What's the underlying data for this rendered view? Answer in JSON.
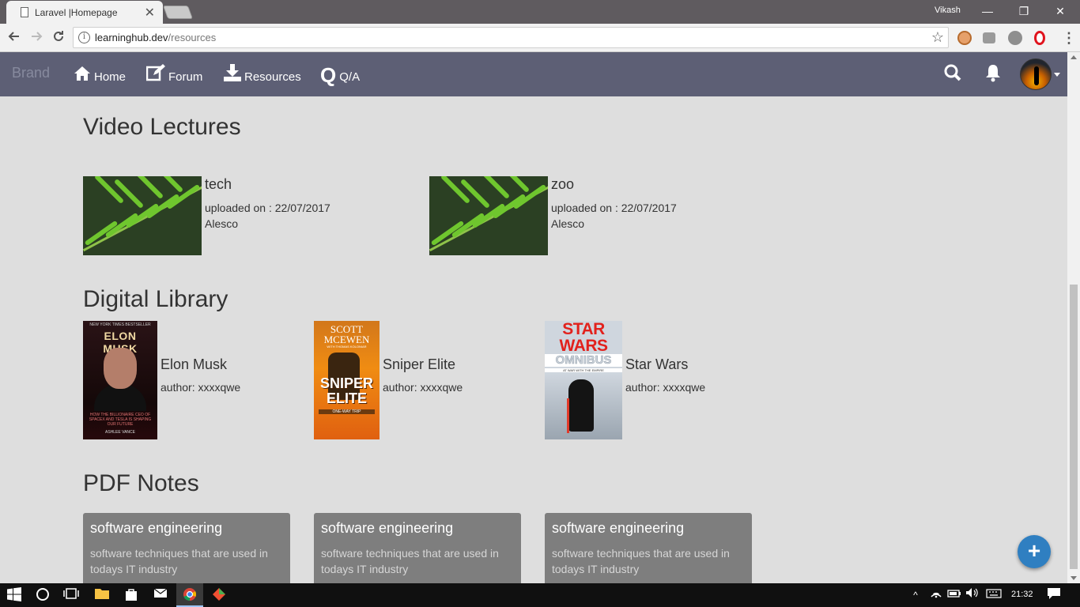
{
  "browser": {
    "tab_title": "Laravel |Homepage",
    "tab_close": "✕",
    "user": "Vikash",
    "url_host": "learninghub.dev",
    "url_path": "/resources",
    "win_min": "—",
    "win_restore": "❐",
    "win_close": "✕"
  },
  "navbar": {
    "brand": "Brand",
    "items": [
      {
        "label": "Home",
        "icon": "home-icon"
      },
      {
        "label": "Forum",
        "icon": "edit-icon"
      },
      {
        "label": "Resources",
        "icon": "download-icon"
      },
      {
        "label": "Q/A",
        "icon": "q-icon"
      }
    ],
    "right_icons": [
      "search-icon",
      "bell-icon",
      "avatar"
    ]
  },
  "sections": {
    "videos_title": "Video Lectures",
    "library_title": "Digital Library",
    "pdf_title": "PDF Notes"
  },
  "videos": [
    {
      "title": "tech",
      "meta": "uploaded on : 22/07/2017",
      "author": "Alesco"
    },
    {
      "title": "zoo",
      "meta": "uploaded on : 22/07/2017",
      "author": "Alesco"
    }
  ],
  "books": [
    {
      "title": "Elon Musk",
      "author": "author: xxxxqwe",
      "cover_lines": [
        "NEW YORK TIMES BESTSELLER",
        "ELON MUSK",
        "HOW THE BILLIONAIRE CEO OF SPACEX AND TESLA IS SHAPING OUR FUTURE",
        "ASHLEE VANCE"
      ]
    },
    {
      "title": "Sniper Elite",
      "author": "author: xxxxqwe",
      "cover_lines": [
        "SCOTT MCEWEN",
        "WITH THOMAS KOLONIAR",
        "SNIPER ELITE",
        "ONE-WAY TRIP"
      ]
    },
    {
      "title": "Star Wars",
      "author": "author: xxxxqwe",
      "cover_lines": [
        "STAR WARS",
        "OMNIBUS",
        "AT WAR WITH THE EMPIRE"
      ]
    }
  ],
  "pdfs": [
    {
      "title": "software engineering",
      "desc": "software techniques that are used in todays IT industry"
    },
    {
      "title": "software engineering",
      "desc": "software techniques that are used in todays IT industry"
    },
    {
      "title": "software engineering",
      "desc": "software techniques that are used in todays IT industry"
    }
  ],
  "fab_label": "+",
  "taskbar": {
    "time": "21:32"
  },
  "colors": {
    "navbar": "#5d5f75",
    "page_bg": "#dedede",
    "pdf_card": "#7e7e7e",
    "fab": "#2f7fc1"
  }
}
